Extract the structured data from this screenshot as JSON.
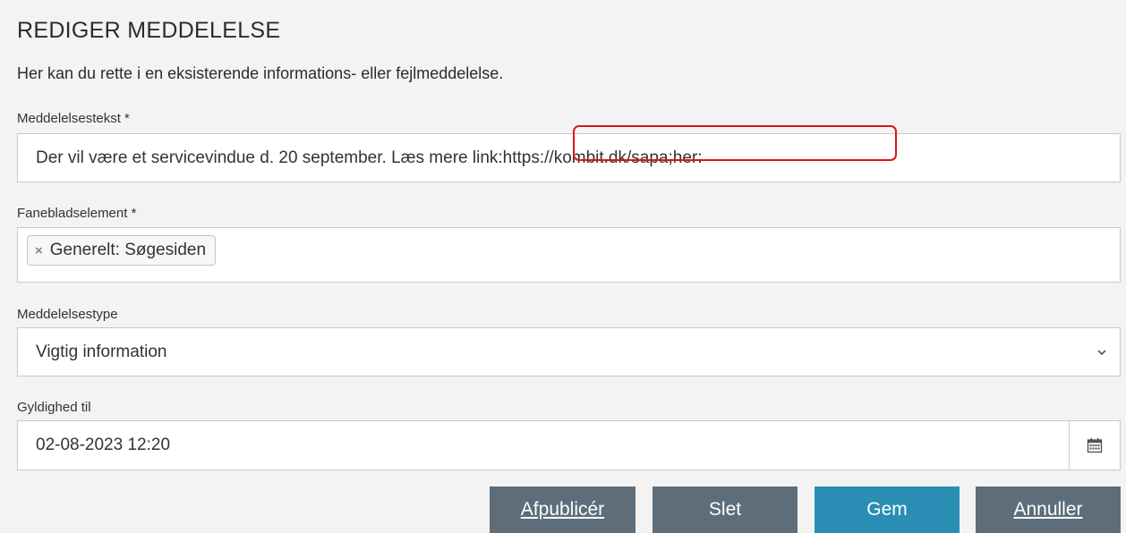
{
  "header": {
    "title": "REDIGER MEDDELELSE",
    "intro": "Her kan du rette i en eksisterende informations- eller fejlmeddelelse."
  },
  "form": {
    "message_text": {
      "label": "Meddelelsestekst *",
      "value": "Der vil være et servicevindue d. 20 september. Læs mere link:https://kombit.dk/sapa;her:"
    },
    "tab_element": {
      "label": "Fanebladselement *",
      "tags": [
        "Generelt: Søgesiden"
      ]
    },
    "message_type": {
      "label": "Meddelelsestype",
      "selected": "Vigtig information"
    },
    "valid_until": {
      "label": "Gyldighed til",
      "value": "02-08-2023 12:20",
      "icon": "calendar-icon"
    }
  },
  "actions": {
    "unpublish": "Afpublicér",
    "delete": "Slet",
    "save": "Gem",
    "cancel": "Annuller"
  },
  "colors": {
    "gray_button": "#5d6e7a",
    "primary_button": "#2a8db4",
    "highlight": "#e0131c"
  }
}
